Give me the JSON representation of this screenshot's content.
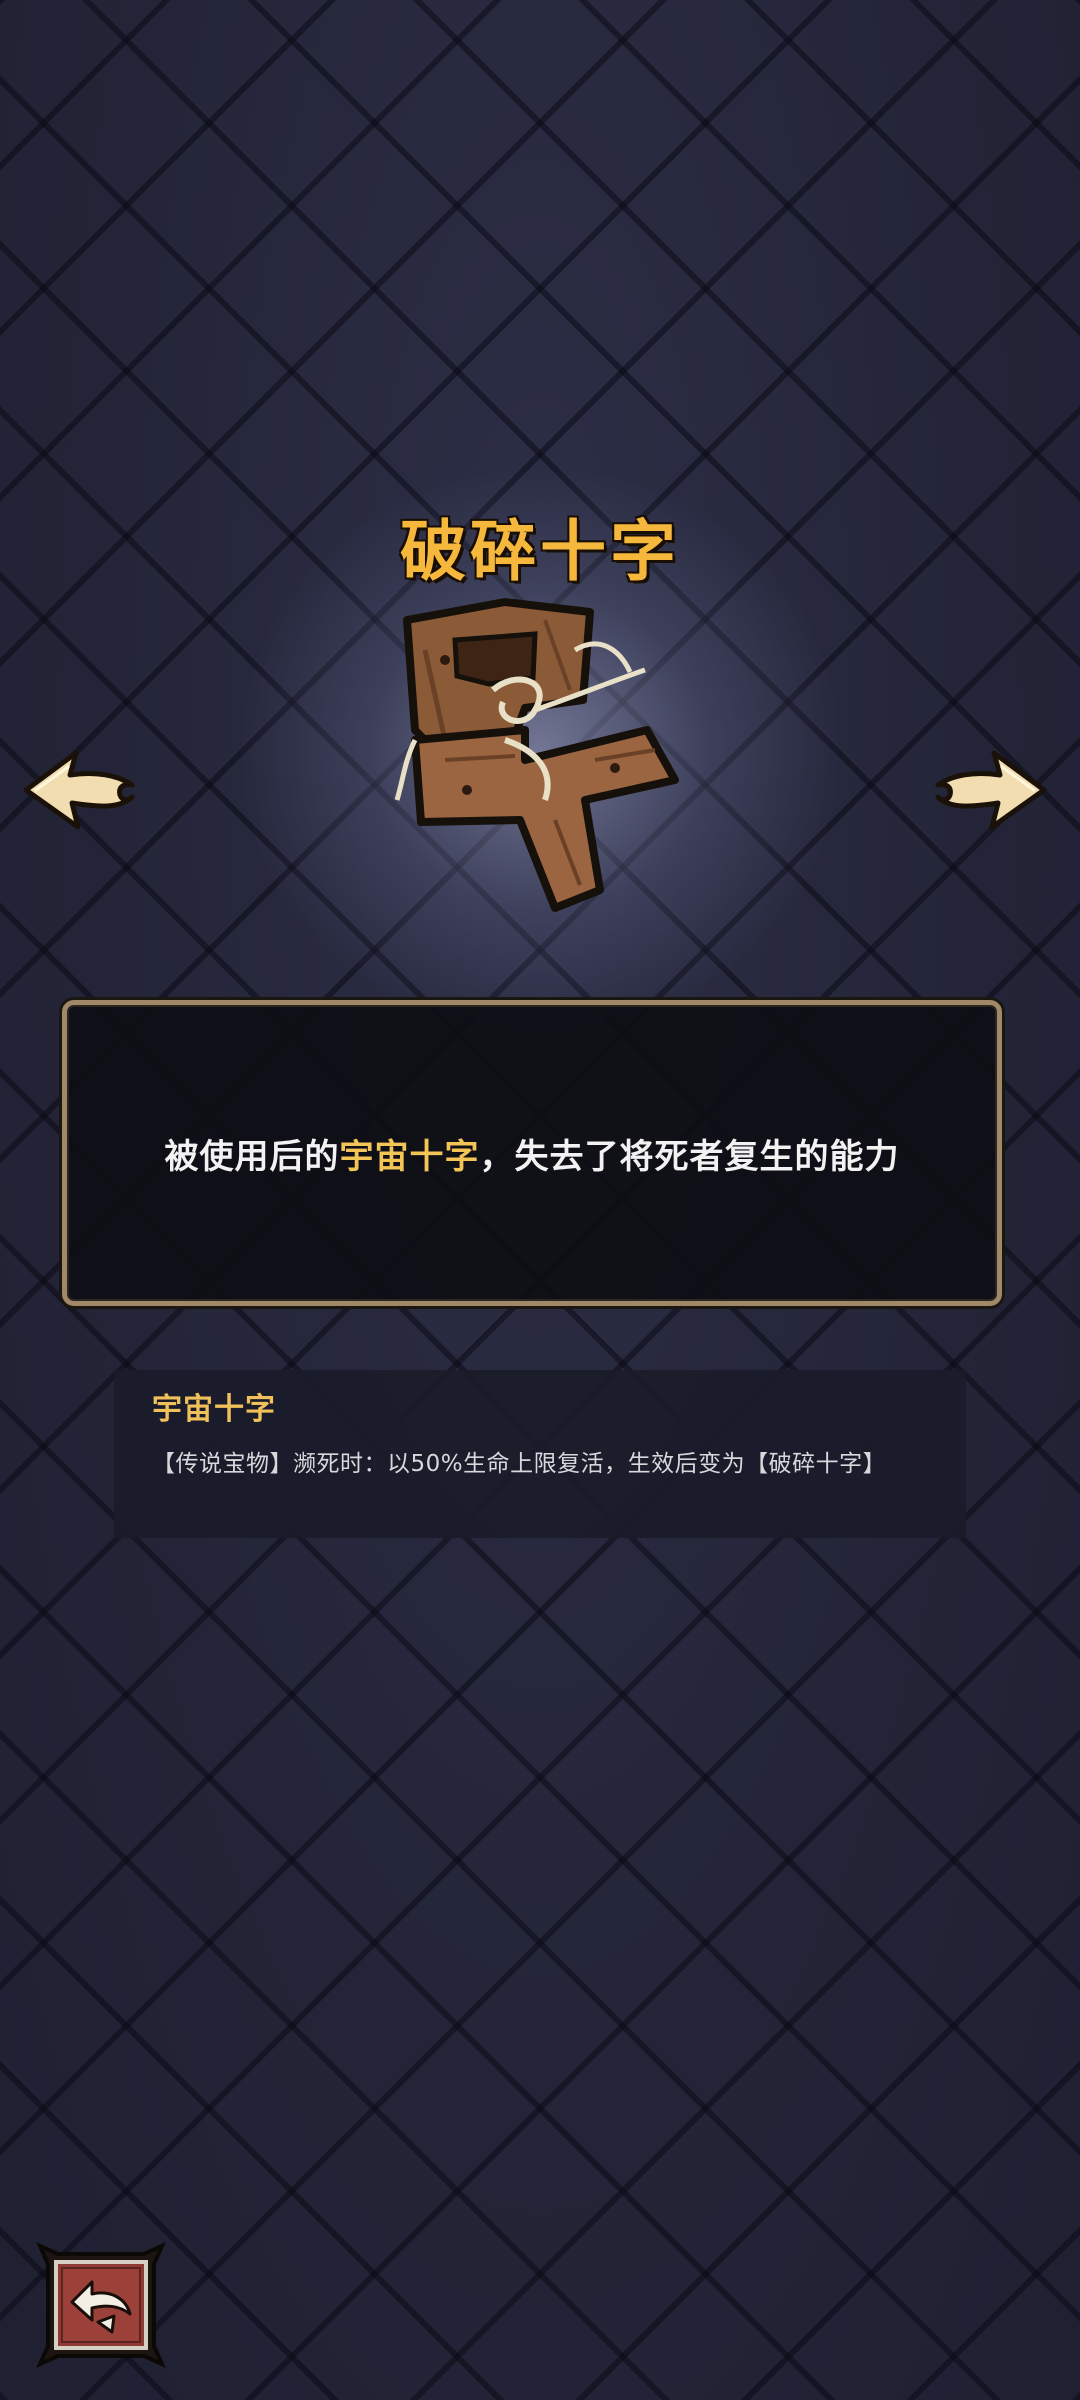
{
  "item": {
    "title": "破碎十字",
    "image_icon": "broken-wooden-cross-icon"
  },
  "navigation": {
    "prev_icon": "arrow-left-icon",
    "next_icon": "arrow-right-icon",
    "back_icon": "return-arrow-icon"
  },
  "description": {
    "prefix": "被使用后的",
    "highlight": "宇宙十字",
    "suffix": "，失去了将死者复生的能力"
  },
  "related": {
    "name": "宇宙十字",
    "description": "【传说宝物】濒死时：以50%生命上限复活，生效后变为【破碎十字】"
  },
  "colors": {
    "title": "#f5b73c",
    "highlight": "#f3c556",
    "panel_border": "#a08868",
    "background": "#242538"
  }
}
